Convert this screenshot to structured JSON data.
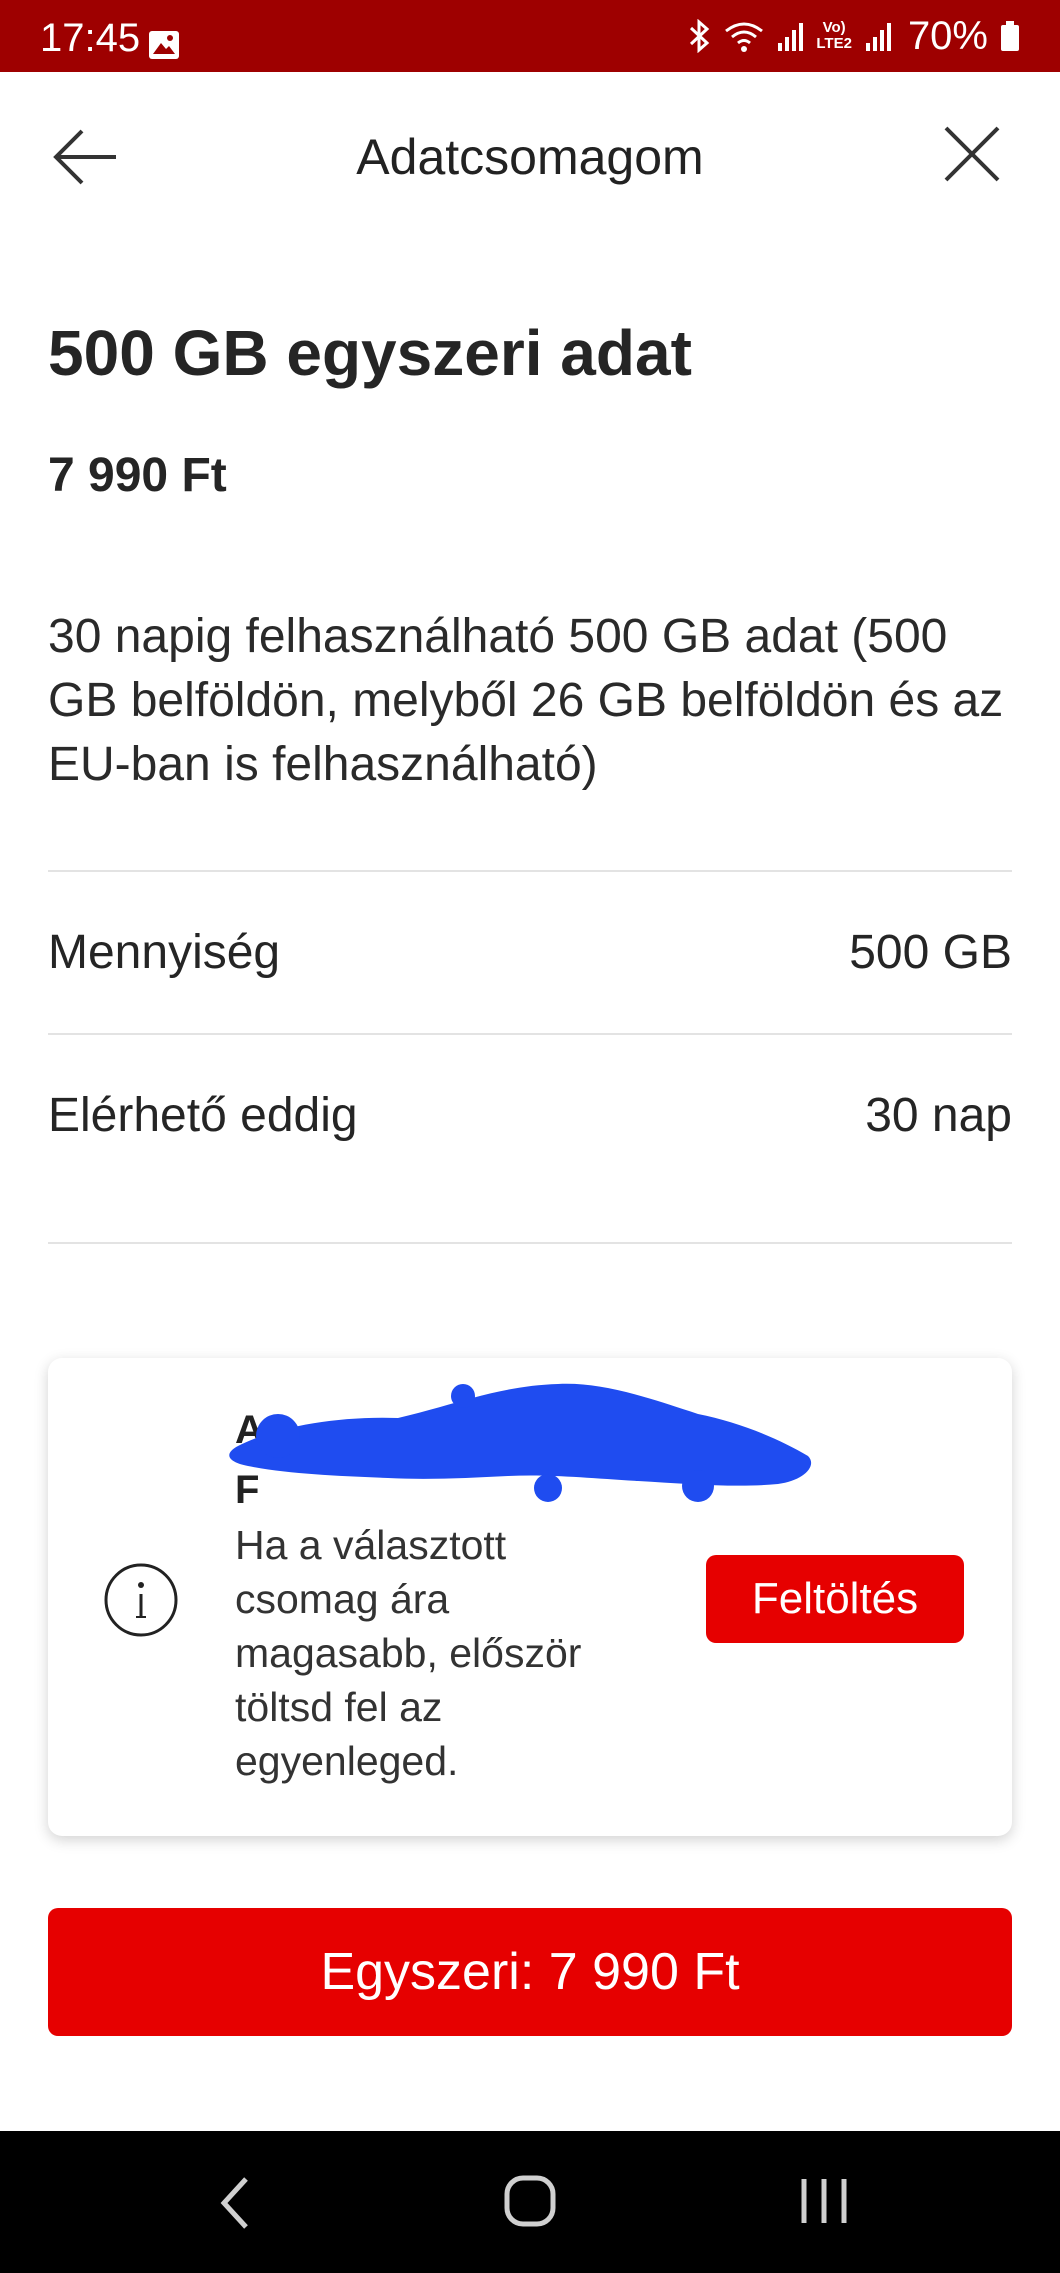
{
  "status_bar": {
    "time": "17:45",
    "network_label_top": "Vo)",
    "network_label_bottom": "LTE2",
    "battery": "70%"
  },
  "header": {
    "title": "Adatcsomagom"
  },
  "product": {
    "title": "500 GB egyszeri adat",
    "price": "7 990 Ft",
    "description": "30 napig felhasználható 500 GB adat (500 GB belföldön, melyből 26 GB belföldön és az EU-ban is felhasználható)"
  },
  "details": [
    {
      "label": "Mennyiség",
      "value": "500 GB"
    },
    {
      "label": "Elérhető eddig",
      "value": "30 nap"
    }
  ],
  "info_card": {
    "heading_line1": "A",
    "heading_line2": "F",
    "text": "Ha a választott csomag ára magasabb, először töltsd fel az egyenleged.",
    "button_label": "Feltöltés"
  },
  "purchase_button": {
    "label": "Egyszeri: 7 990 Ft"
  },
  "colors": {
    "status_bar": "#9e0000",
    "accent": "#e60000",
    "redaction": "#1f4cf0"
  }
}
